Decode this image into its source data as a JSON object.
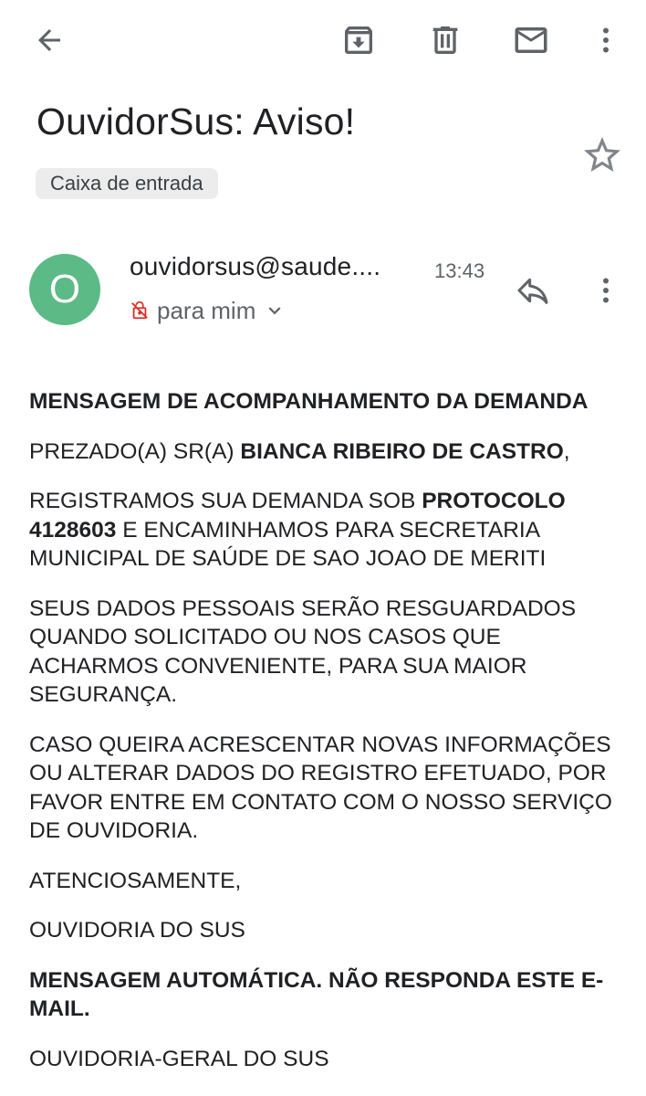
{
  "toolbar": {
    "back_icon": "arrow-back-icon",
    "archive_icon": "archive-icon",
    "delete_icon": "trash-icon",
    "unread_icon": "mail-icon",
    "more_icon": "more-vert-icon"
  },
  "email": {
    "subject": "OuvidorSus: Aviso!",
    "label": "Caixa de entrada",
    "starred": false,
    "sender": {
      "avatar_letter": "O",
      "avatar_color": "#5bba86",
      "address": "ouvidorsus@saude....",
      "time": "13:43",
      "recipient": "para mim"
    },
    "body": {
      "heading": "MENSAGEM DE ACOMPANHAMENTO DA DEMANDA",
      "greeting_prefix": "PREZADO(A) SR(A) ",
      "greeting_name": "BIANCA RIBEIRO DE CASTRO",
      "greeting_suffix": ",",
      "p1_prefix": "REGISTRAMOS SUA DEMANDA SOB ",
      "p1_protocol": "PROTOCOLO 4128603",
      "p1_suffix": " E ENCAMINHAMOS PARA SECRETARIA MUNICIPAL DE SAÚDE DE SAO JOAO DE MERITI",
      "p2": "SEUS DADOS PESSOAIS SERÃO RESGUARDADOS QUANDO SOLICITADO OU NOS CASOS QUE ACHARMOS CONVENIENTE, PARA SUA MAIOR SEGURANÇA.",
      "p3": "CASO QUEIRA ACRESCENTAR NOVAS INFORMAÇÕES OU ALTERAR DADOS DO REGISTRO EFETUADO, POR FAVOR ENTRE EM CONTATO COM O NOSSO SERVIÇO DE OUVIDORIA.",
      "closing": "ATENCIOSAMENTE,",
      "signature": "OUVIDORIA DO SUS",
      "auto_notice": "MENSAGEM AUTOMÁTICA. NÃO RESPONDA ESTE E-MAIL.",
      "footer": "OUVIDORIA-GERAL DO SUS"
    }
  },
  "colors": {
    "icon": "#5f6368",
    "text": "#202124",
    "chip_bg": "#ececec",
    "unencrypted_lock": "#d93025"
  }
}
